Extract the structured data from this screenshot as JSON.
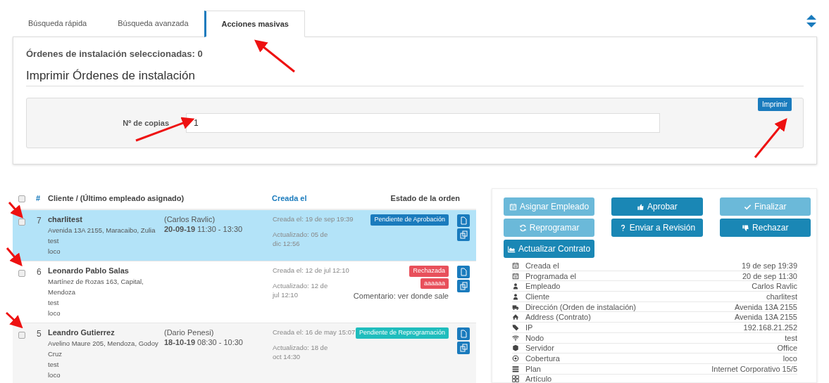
{
  "tabs": [
    {
      "label": "Búsqueda rápida",
      "selected": false
    },
    {
      "label": "Búsqueda avanzada",
      "selected": false
    },
    {
      "label": "Acciones masivas",
      "selected": true
    }
  ],
  "selected_count": "Órdenes de instalación seleccionadas: 0",
  "print_section": {
    "title": "Imprimir Órdenes de instalación",
    "copies_label": "Nº de copias",
    "copies_value": "1",
    "button": "Imprimir"
  },
  "table": {
    "select_all_checked": false,
    "columns": [
      "#",
      "Cliente / (Último empleado asignado)",
      "Creada el",
      "Estado de la orden"
    ],
    "rows": [
      {
        "checked": false,
        "selected": true,
        "number": "7",
        "client": "charlitest",
        "address": "Avenida 13A 2155, Maracaibo, Zulia",
        "lines": [
          "test",
          "loco"
        ],
        "employee": "(Carlos Ravlic)",
        "date": "20-09-19",
        "time": " 11:30 - 13:30",
        "created": "Creada el: 19 de sep 19:39",
        "updated": "Actualizado: 05 de dic 12:56",
        "badges": [
          {
            "label": "Pendiente de Aprobación",
            "color": "#1a7bbd"
          }
        ]
      },
      {
        "checked": false,
        "selected": false,
        "number": "6",
        "client": "Leonardo Pablo Salas",
        "address": "Martínez de Rozas 163, Capital, Mendoza",
        "lines": [
          "test",
          "loco"
        ],
        "created": "Creada el: 12 de jul 12:10",
        "updated": "Actualizado: 12 de jul 12:10",
        "badges": [
          {
            "label": "Rechazada",
            "color": "#e8505b"
          },
          {
            "label": "aaaaaa",
            "color": "#e8505b"
          }
        ],
        "comment": "Comentario: ver donde sale"
      },
      {
        "checked": false,
        "selected": false,
        "number": "5",
        "client": "Leandro Gutierrez",
        "address": "Avelino Maure 205, Mendoza, Godoy Cruz",
        "lines": [
          "test",
          "loco"
        ],
        "employee": "(Dario Penesi)",
        "date": "18-10-19",
        "time": " 08:30 - 10:30",
        "created": "Creada el: 16 de may 15:07",
        "updated": "Actualizado: 18 de oct 14:30",
        "badges": [
          {
            "label": "Pendiente de Reprogramación",
            "color": "#1fbdbd"
          }
        ]
      }
    ]
  },
  "actions": [
    {
      "label": "Asignar Empleado",
      "kind": "calendar",
      "disabled": true
    },
    {
      "label": "Aprobar",
      "kind": "approve",
      "disabled": false
    },
    {
      "label": "Finalizar",
      "kind": "finish",
      "disabled": true
    },
    {
      "label": "Reprogramar",
      "kind": "reschedule",
      "disabled": true
    },
    {
      "label": "Enviar a Revisión",
      "kind": "review",
      "disabled": false
    },
    {
      "label": "Rechazar",
      "kind": "reject",
      "disabled": false
    },
    {
      "label": "Actualizar Contrato",
      "kind": "contract",
      "disabled": false
    }
  ],
  "details": [
    {
      "label": "Creada el",
      "value": "19 de sep 19:39"
    },
    {
      "label": "Programada el",
      "value": "20 de sep 11:30"
    },
    {
      "label": "Empleado",
      "value": "Carlos Ravlic"
    },
    {
      "label": "Cliente",
      "value": "charlitest"
    },
    {
      "label": "Dirección (Orden de instalación)",
      "value": "Avenida 13A 2155"
    },
    {
      "label": "Address (Contrato)",
      "value": "Avenida 13A 2155"
    },
    {
      "label": "IP",
      "value": "192.168.21.252"
    },
    {
      "label": "Nodo",
      "value": "test"
    },
    {
      "label": "Servidor",
      "value": "Office"
    },
    {
      "label": "Cobertura",
      "value": "loco"
    },
    {
      "label": "Plan",
      "value": "Internet Corporativo 15/5"
    },
    {
      "label": "Artículo"
    }
  ]
}
